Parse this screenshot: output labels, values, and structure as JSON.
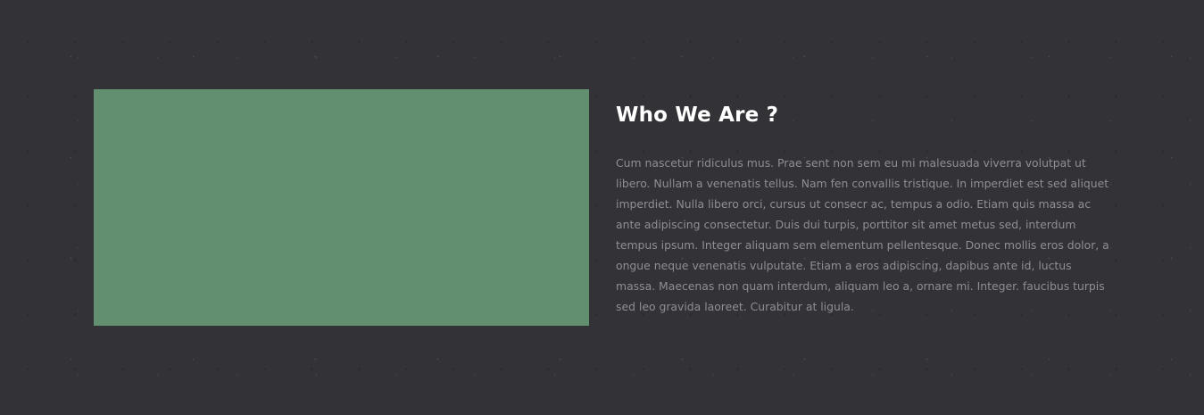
{
  "about": {
    "heading": "Who We Are ?",
    "paragraph": "Cum nascetur ridiculus mus. Prae sent non sem eu mi malesuada viverra volutpat ut libero. Nullam a venenatis tellus. Nam fen convallis tristique. In imperdiet est sed aliquet imperdiet. Nulla libero orci, cursus ut consecr ac, tempus a odio. Etiam quis massa ac ante adipiscing consectetur. Duis dui turpis, porttitor sit amet metus sed, interdum tempus ipsum. Integer aliquam sem elementum pellentesque. Donec mollis eros dolor, a ongue neque venenatis vulputate. Etiam a eros adipiscing, dapibus ante id, luctus massa. Maecenas non quam interdum, aliquam leo a, ornare mi. Integer. faucibus turpis sed leo gravida laoreet. Curabitur at ligula."
  },
  "colors": {
    "background": "#333236",
    "media_placeholder": "#628f70",
    "heading": "#ffffff",
    "body_text": "#8f8e93"
  }
}
